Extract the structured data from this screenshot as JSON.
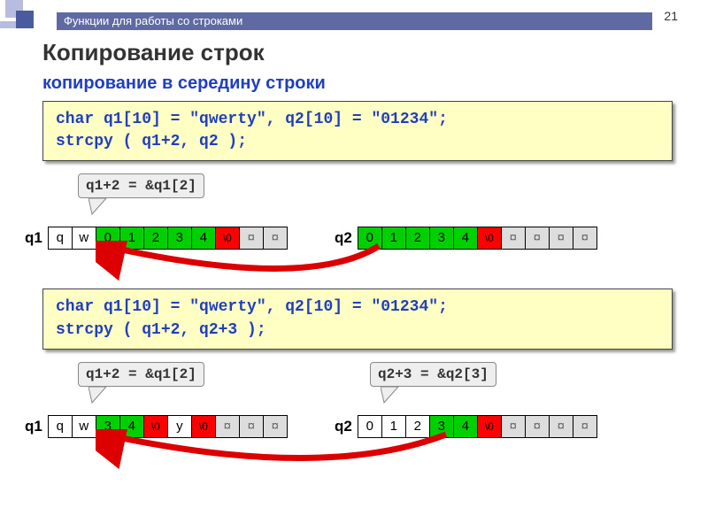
{
  "header": {
    "title": "Функции для работы со строками",
    "page_num": "21"
  },
  "title": "Копирование строк",
  "subtitle": "копирование в середину строки",
  "code1": {
    "line1": "char q1[10] = \"qwerty\", q2[10] = \"01234\";",
    "line2": "strcpy ( q1+2, q2 );"
  },
  "callout1": "q1+2 = &q1[2]",
  "array1a": {
    "label": "q1",
    "cells": [
      "q",
      "w",
      "0",
      "1",
      "2",
      "3",
      "4",
      "\\0",
      "¤",
      "¤"
    ],
    "styles": [
      "w",
      "w",
      "g",
      "g",
      "g",
      "g",
      "g",
      "r",
      "e",
      "e"
    ]
  },
  "array1b": {
    "label": "q2",
    "cells": [
      "0",
      "1",
      "2",
      "3",
      "4",
      "\\0",
      "¤",
      "¤",
      "¤",
      "¤"
    ],
    "styles": [
      "g",
      "g",
      "g",
      "g",
      "g",
      "r",
      "e",
      "e",
      "e",
      "e"
    ]
  },
  "code2": {
    "line1": "char q1[10] = \"qwerty\", q2[10] = \"01234\";",
    "line2": "strcpy ( q1+2, q2+3 );"
  },
  "callout2a": "q1+2 = &q1[2]",
  "callout2b": "q2+3 = &q2[3]",
  "array2a": {
    "label": "q1",
    "cells": [
      "q",
      "w",
      "3",
      "4",
      "\\0",
      "y",
      "\\0",
      "¤",
      "¤",
      "¤"
    ],
    "styles": [
      "w",
      "w",
      "g",
      "g",
      "r",
      "w",
      "r",
      "e",
      "e",
      "e"
    ]
  },
  "array2b": {
    "label": "q2",
    "cells": [
      "0",
      "1",
      "2",
      "3",
      "4",
      "\\0",
      "¤",
      "¤",
      "¤",
      "¤"
    ],
    "styles": [
      "w",
      "w",
      "w",
      "g",
      "g",
      "r",
      "e",
      "e",
      "e",
      "e"
    ]
  }
}
